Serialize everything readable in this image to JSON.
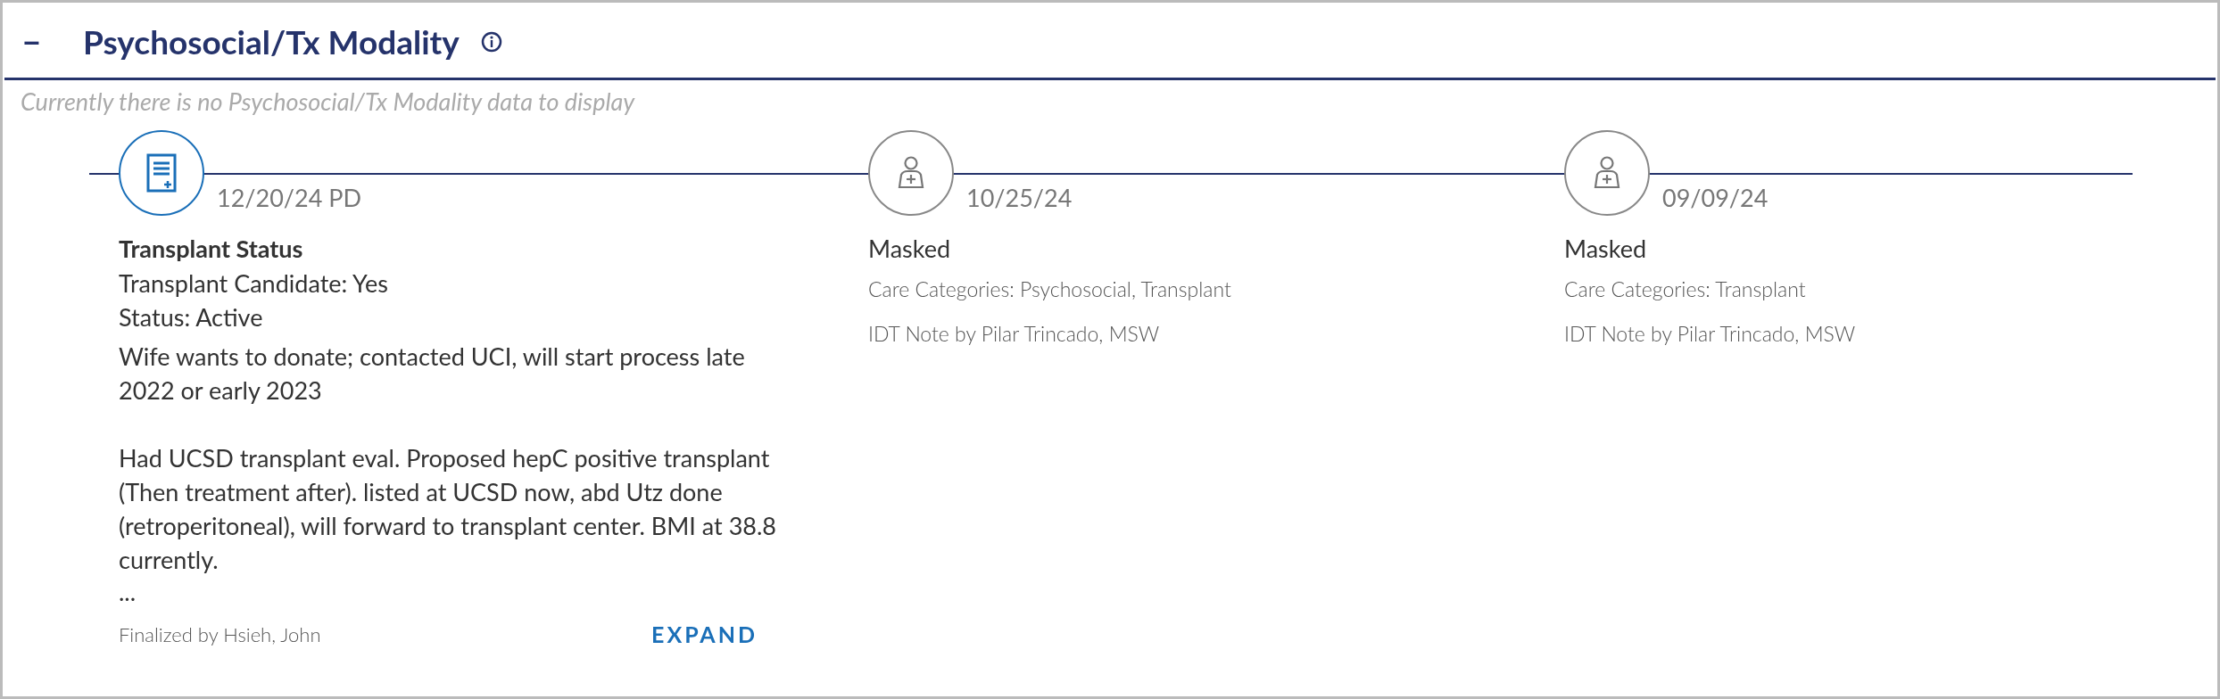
{
  "section": {
    "collapse_icon": "−",
    "title": "Psychosocial/Tx Modality",
    "empty_message": "Currently there is no Psychosocial/Tx Modality data to display"
  },
  "entries": [
    {
      "kind": "note",
      "date": "12/20/24 PD",
      "title": "Transplant Status",
      "lines": [
        "Transplant Candidate: Yes",
        "Status: Active"
      ],
      "paragraphs": [
        "Wife wants to donate; contacted UCI, will start process late 2022 or early 2023",
        "Had UCSD transplant eval. Proposed hepC positive transplant (Then treatment after). listed at UCSD now, abd Utz done (retroperitoneal), will forward to transplant center. BMI at 38.8 currently."
      ],
      "ellipsis": "...",
      "footer": "Finalized by Hsieh, John",
      "action": "EXPAND"
    },
    {
      "kind": "masked",
      "date": "10/25/24",
      "title": "Masked",
      "lines": [
        "Care Categories: Psychosocial, Transplant",
        "IDT Note by Pilar Trincado, MSW"
      ]
    },
    {
      "kind": "masked",
      "date": "09/09/24",
      "title": "Masked",
      "lines": [
        "Care Categories: Transplant",
        "IDT Note by Pilar Trincado, MSW"
      ]
    }
  ]
}
